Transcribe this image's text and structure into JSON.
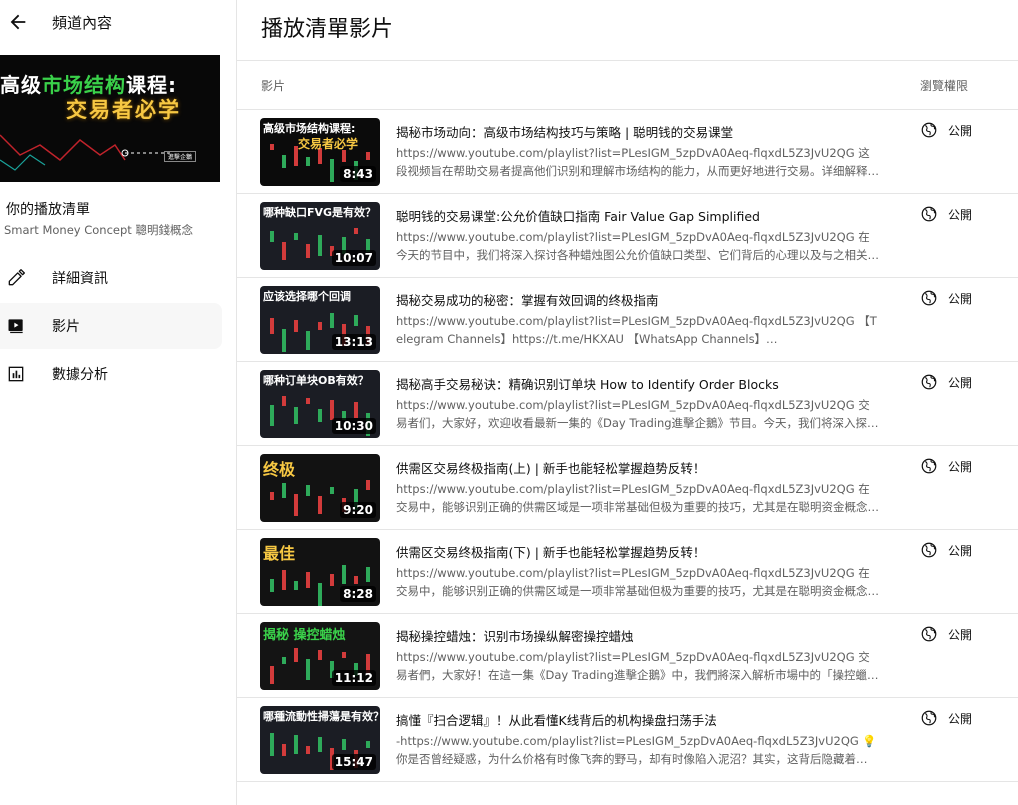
{
  "sidebar": {
    "back_title": "頻道內容",
    "hero": {
      "line1_a": "高级",
      "line1_b": "市场结构",
      "line1_c": "课程:",
      "line2": "交易者必学"
    },
    "playlist_title": "你的播放清單",
    "playlist_subtitle": "Smart Money Concept 聰明錢概念",
    "nav": [
      {
        "label": "詳細資訊",
        "icon": "pencil-icon"
      },
      {
        "label": "影片",
        "icon": "video-icon"
      },
      {
        "label": "數據分析",
        "icon": "analytics-icon"
      }
    ]
  },
  "main": {
    "title": "播放清單影片",
    "col_video": "影片",
    "col_visibility": "瀏覽權限",
    "videos": [
      {
        "title": "揭秘市场动向：高级市场结构技巧与策略 | 聪明钱的交易课堂",
        "desc": "https://www.youtube.com/playlist?list=PLesIGM_5zpDvA0Aeq-flqxdL5Z3JvU2QG 这段视频旨在帮助交易者提高他们识别和理解市场结构的能力，从而更好地进行交易。详细解释…",
        "duration": "8:43",
        "visibility": "公開",
        "thumb_text": "高级市场结构课程:",
        "thumb_text2": "交易者必学",
        "thumb_color": "#0b0b0b"
      },
      {
        "title": "聪明钱的交易课堂:公允价值缺口指南 Fair Value Gap Simplified",
        "desc": "https://www.youtube.com/playlist?list=PLesIGM_5zpDvA0Aeq-flqxdL5Z3JvU2QG 在今天的节目中，我们将深入探讨各种蜡烛图公允价值缺口类型、它们背后的心理以及与之相关…",
        "duration": "10:07",
        "visibility": "公開",
        "thumb_text": "哪种缺口FVG是有效？",
        "thumb_text2": "",
        "thumb_color": "#1b1d24"
      },
      {
        "title": "揭秘交易成功的秘密：掌握有效回调的终极指南",
        "desc": "https://www.youtube.com/playlist?list=PLesIGM_5zpDvA0Aeq-flqxdL5Z3JvU2QG 【Telegram Channels】https://t.me/HKXAU 【WhatsApp Channels】…",
        "duration": "13:13",
        "visibility": "公開",
        "thumb_text": "应该选择哪个回调",
        "thumb_text2": "",
        "thumb_color": "#1b1d24"
      },
      {
        "title": "揭秘高手交易秘诀：精确识别订单块 How to Identify Order Blocks",
        "desc": "https://www.youtube.com/playlist?list=PLesIGM_5zpDvA0Aeq-flqxdL5Z3JvU2QG 交易者们，大家好，欢迎收看最新一集的《Day Trading進擊企鵝》节目。今天，我们将深入探…",
        "duration": "10:30",
        "visibility": "公開",
        "thumb_text": "哪种订单块OB有效？",
        "thumb_text2": "",
        "thumb_color": "#1b1d24"
      },
      {
        "title": "供需区交易终极指南(上) | 新手也能轻松掌握趋势反转！",
        "desc": "https://www.youtube.com/playlist?list=PLesIGM_5zpDvA0Aeq-flqxdL5Z3JvU2QG 在交易中，能够识别正确的供需区域是一项非常基础但极为重要的技巧，尤其是在聪明资金概念…",
        "duration": "9:20",
        "visibility": "公開",
        "thumb_text": "终极",
        "thumb_text2": "",
        "thumb_color": "#121212"
      },
      {
        "title": "供需区交易终极指南(下) | 新手也能轻松掌握趋势反转！",
        "desc": "https://www.youtube.com/playlist?list=PLesIGM_5zpDvA0Aeq-flqxdL5Z3JvU2QG 在交易中，能够识别正确的供需区域是一项非常基础但极为重要的技巧，尤其是在聪明资金概念…",
        "duration": "8:28",
        "visibility": "公開",
        "thumb_text": "最佳",
        "thumb_text2": "",
        "thumb_color": "#121212"
      },
      {
        "title": "揭秘操控蜡烛：识别市场操纵解密操控蜡烛",
        "desc": "https://www.youtube.com/playlist?list=PLesIGM_5zpDvA0Aeq-flqxdL5Z3JvU2QG 交易者們，大家好！在這一集《Day Trading進擊企鵝》中，我們將深入解析市場中的「操控蠟…",
        "duration": "11:12",
        "visibility": "公開",
        "thumb_text": "揭秘 操控蜡烛",
        "thumb_text2": "",
        "thumb_color": "#141414"
      },
      {
        "title": "搞懂『扫合逻辑』！从此看懂K线背后的机构操盘扫荡手法",
        "desc": "-https://www.youtube.com/playlist?list=PLesIGM_5zpDvA0Aeq-flqxdL5Z3JvU2QG 💡你是否曾经疑惑，为什么价格有时像飞奔的野马，却有时像陷入泥沼？其实，这背后隐藏着…",
        "duration": "15:47",
        "visibility": "公開",
        "thumb_text": "哪種流動性掃蕩是有效？",
        "thumb_text2": "",
        "thumb_color": "#1b1d24"
      }
    ]
  }
}
